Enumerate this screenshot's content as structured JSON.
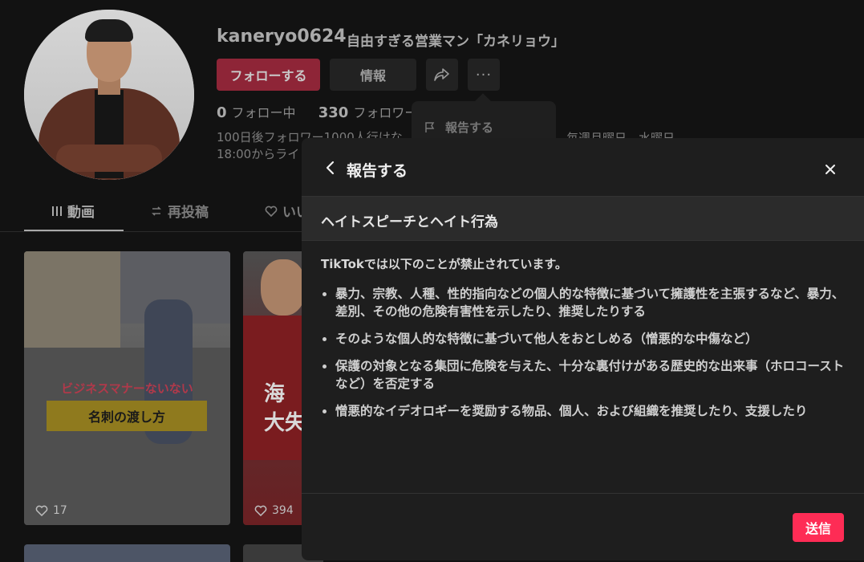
{
  "profile": {
    "username": "kaneryo0624",
    "nickname": "自由すぎる営業マン「カネリョウ」",
    "follow_label": "フォローする",
    "info_label": "情報",
    "more_label": "···",
    "following_count": "0",
    "following_label": "フォロー中",
    "followers_count": "330",
    "followers_label": "フォロワー",
    "bio_line1": "100日後フォロワー1000人行けな",
    "bio_line2": "18:00からライ",
    "bio_right": "毎週月曜日、水曜日"
  },
  "dropdown": {
    "report_label": "報告する"
  },
  "tabs": [
    {
      "label": "動画"
    },
    {
      "label": "再投稿"
    },
    {
      "label": "いい"
    }
  ],
  "videos": [
    {
      "caption_red": "ビジネスマナーないない",
      "caption_box": "名刺の渡し方",
      "likes": "17"
    },
    {
      "big_text_1": "海",
      "big_text_2": "大失",
      "likes": "394"
    }
  ],
  "modal": {
    "title": "報告する",
    "category": "ヘイトスピーチとヘイト行為",
    "intro": "TikTokでは以下のことが禁止されています。",
    "rules": [
      "暴力、宗教、人種、性的指向などの個人的な特徴に基づいて擁護性を主張するなど、暴力、差別、その他の危険有害性を示したり、推奨したりする",
      "そのような個人的な特徴に基づいて他人をおとしめる（憎悪的な中傷など）",
      "保護の対象となる集団に危険を与えた、十分な裏付けがある歴史的な出来事（ホロコーストなど）を否定する",
      "憎悪的なイデオロギーを奨励する物品、個人、および組織を推奨したり、支援したり"
    ],
    "submit_label": "送信"
  }
}
